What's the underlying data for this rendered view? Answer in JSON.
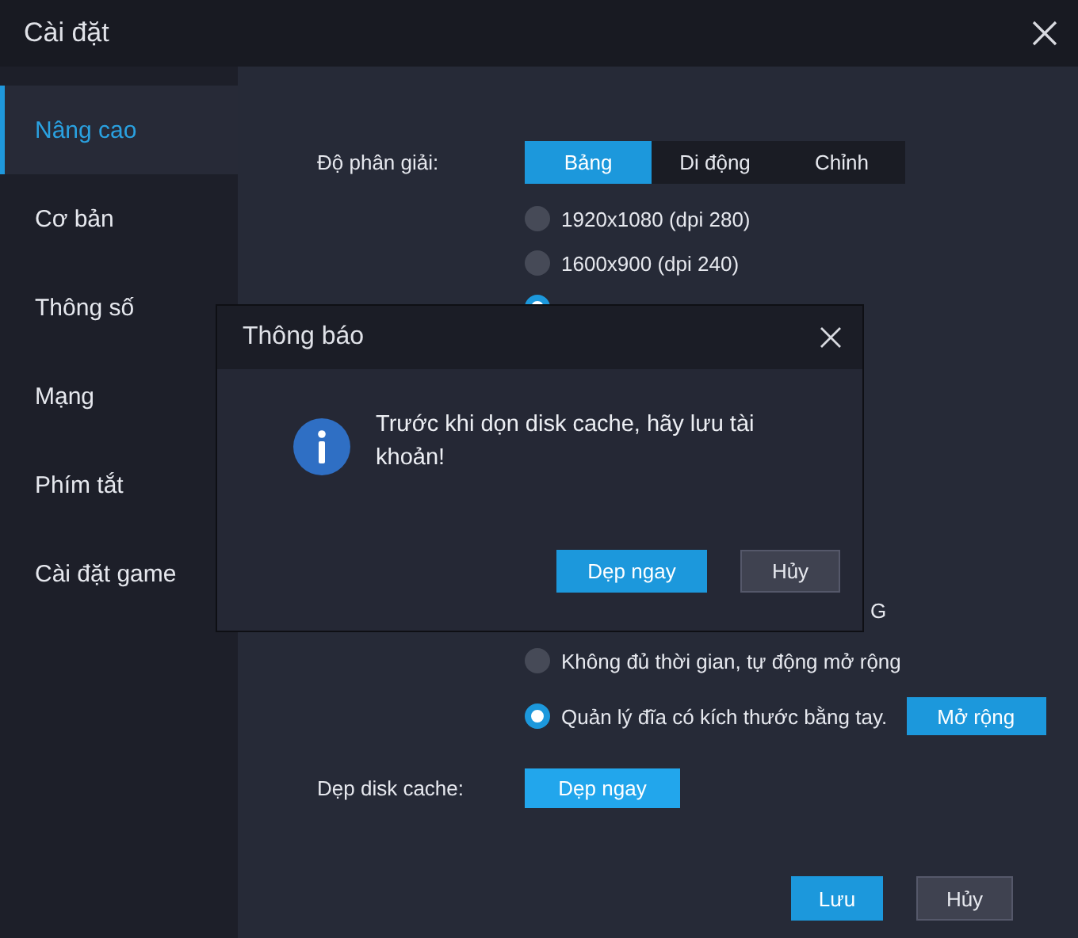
{
  "window": {
    "title": "Cài đặt"
  },
  "sidebar": {
    "items": [
      {
        "label": "Nâng cao",
        "selected": true
      },
      {
        "label": "Cơ bản",
        "selected": false
      },
      {
        "label": "Thông số",
        "selected": false
      },
      {
        "label": "Mạng",
        "selected": false
      },
      {
        "label": "Phím tắt",
        "selected": false
      },
      {
        "label": "Cài đặt game",
        "selected": false
      }
    ]
  },
  "resolution": {
    "label": "Độ phân giải:",
    "tabs": [
      {
        "label": "Bảng",
        "selected": true
      },
      {
        "label": "Di động",
        "selected": false
      },
      {
        "label": "Chỉnh",
        "selected": false
      }
    ],
    "options": [
      {
        "label": "1920x1080  (dpi 280)",
        "selected": false
      },
      {
        "label": "1600x900  (dpi 240)",
        "selected": false
      },
      {
        "selected": true
      }
    ]
  },
  "disk": {
    "partial_text": "G",
    "options": [
      {
        "label": "Không đủ thời gian, tự động mở rộng",
        "selected": false
      },
      {
        "label": "Quản lý đĩa có kích thước bằng tay.",
        "selected": true,
        "button": "Mở rộng"
      }
    ]
  },
  "cache": {
    "label": "Dẹp disk cache:",
    "button": "Dẹp ngay"
  },
  "footer": {
    "buttons": [
      {
        "label": "Lưu",
        "kind": "primary"
      },
      {
        "label": "Hủy",
        "kind": "secondary"
      }
    ]
  },
  "dialog": {
    "title": "Thông báo",
    "message": "Trước khi dọn disk cache, hãy lưu tài khoản!",
    "buttons": [
      {
        "label": "Dẹp ngay",
        "kind": "primary"
      },
      {
        "label": "Hủy",
        "kind": "secondary"
      }
    ]
  }
}
